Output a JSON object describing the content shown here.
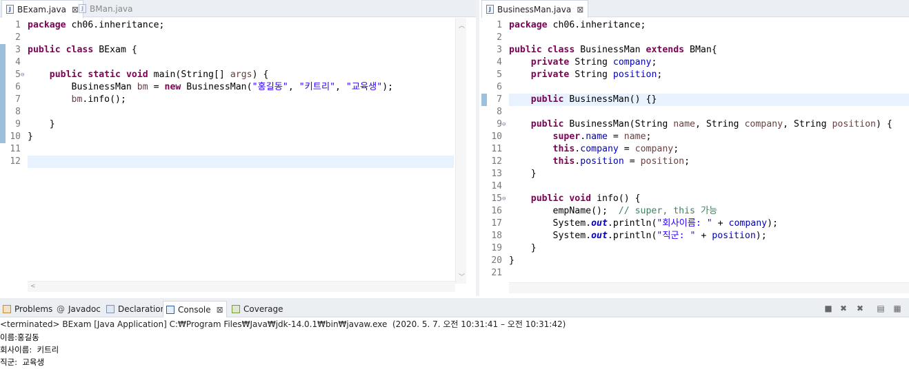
{
  "left_editor": {
    "tabs": [
      {
        "label": "BExam.java",
        "active": true,
        "close": "⊠"
      },
      {
        "label": "BMan.java",
        "active": false
      }
    ],
    "lines": [
      {
        "n": "1",
        "segs": [
          {
            "t": "package",
            "c": "kw"
          },
          {
            "t": " ch06.inheritance;"
          }
        ]
      },
      {
        "n": "2",
        "segs": []
      },
      {
        "n": "3",
        "segs": [
          {
            "t": "public",
            "c": "kw"
          },
          {
            "t": " "
          },
          {
            "t": "class",
            "c": "kw"
          },
          {
            "t": " BExam {"
          }
        ]
      },
      {
        "n": "4",
        "segs": []
      },
      {
        "n": "5",
        "fold": true,
        "segs": [
          {
            "t": "    "
          },
          {
            "t": "public",
            "c": "kw"
          },
          {
            "t": " "
          },
          {
            "t": "static",
            "c": "kw"
          },
          {
            "t": " "
          },
          {
            "t": "void",
            "c": "kw"
          },
          {
            "t": " main(String[] "
          },
          {
            "t": "args",
            "c": "loc"
          },
          {
            "t": ") {"
          }
        ]
      },
      {
        "n": "6",
        "segs": [
          {
            "t": "        BusinessMan "
          },
          {
            "t": "bm",
            "c": "loc"
          },
          {
            "t": " = "
          },
          {
            "t": "new",
            "c": "kw"
          },
          {
            "t": " BusinessMan("
          },
          {
            "t": "\"홍길동\"",
            "c": "str"
          },
          {
            "t": ", "
          },
          {
            "t": "\"키트리\"",
            "c": "str"
          },
          {
            "t": ", "
          },
          {
            "t": "\"교육생\"",
            "c": "str"
          },
          {
            "t": ");"
          }
        ]
      },
      {
        "n": "7",
        "segs": [
          {
            "t": "        "
          },
          {
            "t": "bm",
            "c": "loc"
          },
          {
            "t": ".info();"
          }
        ]
      },
      {
        "n": "8",
        "segs": []
      },
      {
        "n": "9",
        "segs": [
          {
            "t": "    }"
          }
        ]
      },
      {
        "n": "10",
        "segs": [
          {
            "t": "}"
          }
        ]
      },
      {
        "n": "11",
        "segs": []
      },
      {
        "n": "12",
        "segs": [],
        "highlight": true
      }
    ],
    "change_marks": [
      3,
      4,
      5,
      6,
      7,
      8,
      9,
      10
    ]
  },
  "right_editor": {
    "tabs": [
      {
        "label": "BusinessMan.java",
        "active": true,
        "close": "⊠"
      }
    ],
    "lines": [
      {
        "n": "1",
        "segs": [
          {
            "t": "package",
            "c": "kw"
          },
          {
            "t": " ch06.inheritance;"
          }
        ]
      },
      {
        "n": "2",
        "segs": []
      },
      {
        "n": "3",
        "segs": [
          {
            "t": "public",
            "c": "kw"
          },
          {
            "t": " "
          },
          {
            "t": "class",
            "c": "kw"
          },
          {
            "t": " BusinessMan "
          },
          {
            "t": "extends",
            "c": "kw"
          },
          {
            "t": " BMan{"
          }
        ]
      },
      {
        "n": "4",
        "segs": [
          {
            "t": "    "
          },
          {
            "t": "private",
            "c": "kw"
          },
          {
            "t": " String "
          },
          {
            "t": "company",
            "c": "fld"
          },
          {
            "t": ";"
          }
        ]
      },
      {
        "n": "5",
        "segs": [
          {
            "t": "    "
          },
          {
            "t": "private",
            "c": "kw"
          },
          {
            "t": " String "
          },
          {
            "t": "position",
            "c": "fld"
          },
          {
            "t": ";"
          }
        ]
      },
      {
        "n": "6",
        "segs": []
      },
      {
        "n": "7",
        "highlight": true,
        "segs": [
          {
            "t": "    "
          },
          {
            "t": "public",
            "c": "kw"
          },
          {
            "t": " BusinessMan() {}"
          }
        ]
      },
      {
        "n": "8",
        "segs": []
      },
      {
        "n": "9",
        "fold": true,
        "segs": [
          {
            "t": "    "
          },
          {
            "t": "public",
            "c": "kw"
          },
          {
            "t": " BusinessMan(String "
          },
          {
            "t": "name",
            "c": "loc"
          },
          {
            "t": ", String "
          },
          {
            "t": "company",
            "c": "loc"
          },
          {
            "t": ", String "
          },
          {
            "t": "position",
            "c": "loc"
          },
          {
            "t": ") {"
          }
        ]
      },
      {
        "n": "10",
        "segs": [
          {
            "t": "        "
          },
          {
            "t": "super",
            "c": "kw"
          },
          {
            "t": "."
          },
          {
            "t": "name",
            "c": "fld"
          },
          {
            "t": " = "
          },
          {
            "t": "name",
            "c": "loc"
          },
          {
            "t": ";"
          }
        ]
      },
      {
        "n": "11",
        "segs": [
          {
            "t": "        "
          },
          {
            "t": "this",
            "c": "kw"
          },
          {
            "t": "."
          },
          {
            "t": "company",
            "c": "fld"
          },
          {
            "t": " = "
          },
          {
            "t": "company",
            "c": "loc"
          },
          {
            "t": ";"
          }
        ]
      },
      {
        "n": "12",
        "segs": [
          {
            "t": "        "
          },
          {
            "t": "this",
            "c": "kw"
          },
          {
            "t": "."
          },
          {
            "t": "position",
            "c": "fld"
          },
          {
            "t": " = "
          },
          {
            "t": "position",
            "c": "loc"
          },
          {
            "t": ";"
          }
        ]
      },
      {
        "n": "13",
        "segs": [
          {
            "t": "    }"
          }
        ]
      },
      {
        "n": "14",
        "segs": []
      },
      {
        "n": "15",
        "fold": true,
        "segs": [
          {
            "t": "    "
          },
          {
            "t": "public",
            "c": "kw"
          },
          {
            "t": " "
          },
          {
            "t": "void",
            "c": "kw"
          },
          {
            "t": " info() {"
          }
        ]
      },
      {
        "n": "16",
        "segs": [
          {
            "t": "        empName();  "
          },
          {
            "t": "// super, this 가능",
            "c": "cmt"
          }
        ]
      },
      {
        "n": "17",
        "segs": [
          {
            "t": "        System."
          },
          {
            "t": "out",
            "c": "sfld"
          },
          {
            "t": ".println("
          },
          {
            "t": "\"회사이름: \"",
            "c": "str"
          },
          {
            "t": " + "
          },
          {
            "t": "company",
            "c": "fld"
          },
          {
            "t": ");"
          }
        ]
      },
      {
        "n": "18",
        "segs": [
          {
            "t": "        System."
          },
          {
            "t": "out",
            "c": "sfld"
          },
          {
            "t": ".println("
          },
          {
            "t": "\"직군: \"",
            "c": "str"
          },
          {
            "t": " + "
          },
          {
            "t": "position",
            "c": "fld"
          },
          {
            "t": ");"
          }
        ]
      },
      {
        "n": "19",
        "segs": [
          {
            "t": "    }"
          }
        ]
      },
      {
        "n": "20",
        "segs": [
          {
            "t": "}"
          }
        ]
      },
      {
        "n": "21",
        "segs": []
      }
    ],
    "change_marks": [
      7
    ]
  },
  "console": {
    "tabs": [
      {
        "label": "Problems",
        "icon": "problems-icon"
      },
      {
        "label": "Javadoc",
        "icon": "javadoc-icon",
        "glyph": "@"
      },
      {
        "label": "Declaration",
        "icon": "declaration-icon"
      },
      {
        "label": "Console",
        "icon": "console-icon",
        "active": true,
        "close": "⊠"
      },
      {
        "label": "Coverage",
        "icon": "coverage-icon"
      }
    ],
    "terminated": "<terminated> BExam [Java Application] C:₩Program Files₩Java₩jdk-14.0.1₩bin₩javaw.exe  (2020. 5. 7. 오전 10:31:41 – 오전 10:31:42)",
    "output": [
      "이름:홍길동",
      "회사이름:  키트리",
      "직군:  교육생"
    ]
  }
}
